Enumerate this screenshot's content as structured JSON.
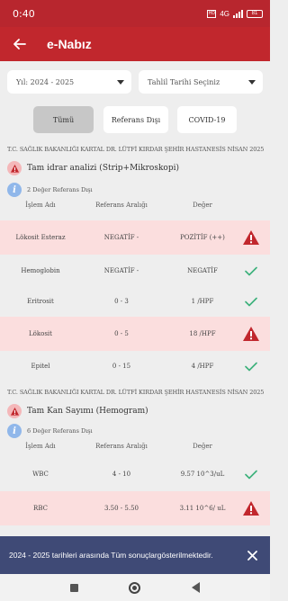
{
  "status_bar": {
    "time": "0:40",
    "network": "4G",
    "battery": "81"
  },
  "app_bar": {
    "title": "e-Nabız",
    "back_icon": "arrow-left-icon"
  },
  "filters": {
    "year": "Yıl: 2024 - 2025",
    "date": "Tahlil Tarihi Seçiniz"
  },
  "chips": [
    {
      "label": "Tümü",
      "selected": true
    },
    {
      "label": "Referans Dışı",
      "selected": false
    },
    {
      "label": "COVID-19",
      "selected": false
    }
  ],
  "sections": [
    {
      "hospital": "T.C. SAĞLIK BAKANLIĞI KARTAL DR. LÜTFİ KIRDAR ŞEHİR HASTANESİS NİSAN 2025",
      "test_name": "Tam idrar analizi (Strip+Mikroskopi)",
      "info": "2 Değer Referans Dışı",
      "headers": {
        "name": "İşlem Adı",
        "range": "Referans Aralığı",
        "value": "Değer"
      },
      "rows": [
        {
          "name": "Lökosit Esteraz",
          "range": "NEGATİF -",
          "value": "POZİTİF (++)",
          "status": "alert"
        },
        {
          "name": "Hemoglobin",
          "range": "NEGATİF -",
          "value": "NEGATİF",
          "status": "ok"
        },
        {
          "name": "Eritrosit",
          "range": "0 - 3",
          "value": "1 /HPF",
          "status": "ok"
        },
        {
          "name": "Lökosit",
          "range": "0 - 5",
          "value": "18 /HPF",
          "status": "alert"
        },
        {
          "name": "Epitel",
          "range": "0 - 15",
          "value": "4 /HPF",
          "status": "ok"
        }
      ]
    },
    {
      "hospital": "T.C. SAĞLIK BAKANLIĞI KARTAL DR. LÜTFİ KIRDAR ŞEHİR HASTANESİS NİSAN 2025",
      "test_name": "Tam Kan Sayımı (Hemogram)",
      "info": "6 Değer Referans Dışı",
      "headers": {
        "name": "İşlem Adı",
        "range": "Referans Aralığı",
        "value": "Değer"
      },
      "rows": [
        {
          "name": "WBC",
          "range": "4 - 10",
          "value": "9.57 10^3/uL",
          "status": "ok"
        },
        {
          "name": "RBC",
          "range": "3.50 - 5.50",
          "value": "3.11 10^6/ uL",
          "status": "alert"
        }
      ]
    }
  ],
  "snackbar": {
    "message": "2024 - 2025 tarihleri arasında Tüm sonuçlargösterilmektedir.",
    "close_icon": "close-icon"
  },
  "colors": {
    "primary": "#c1272d",
    "alert_row": "#fbdede",
    "ok_check": "#3bb07a",
    "snackbar": "#3f4a76",
    "info": "#90b7ea"
  }
}
